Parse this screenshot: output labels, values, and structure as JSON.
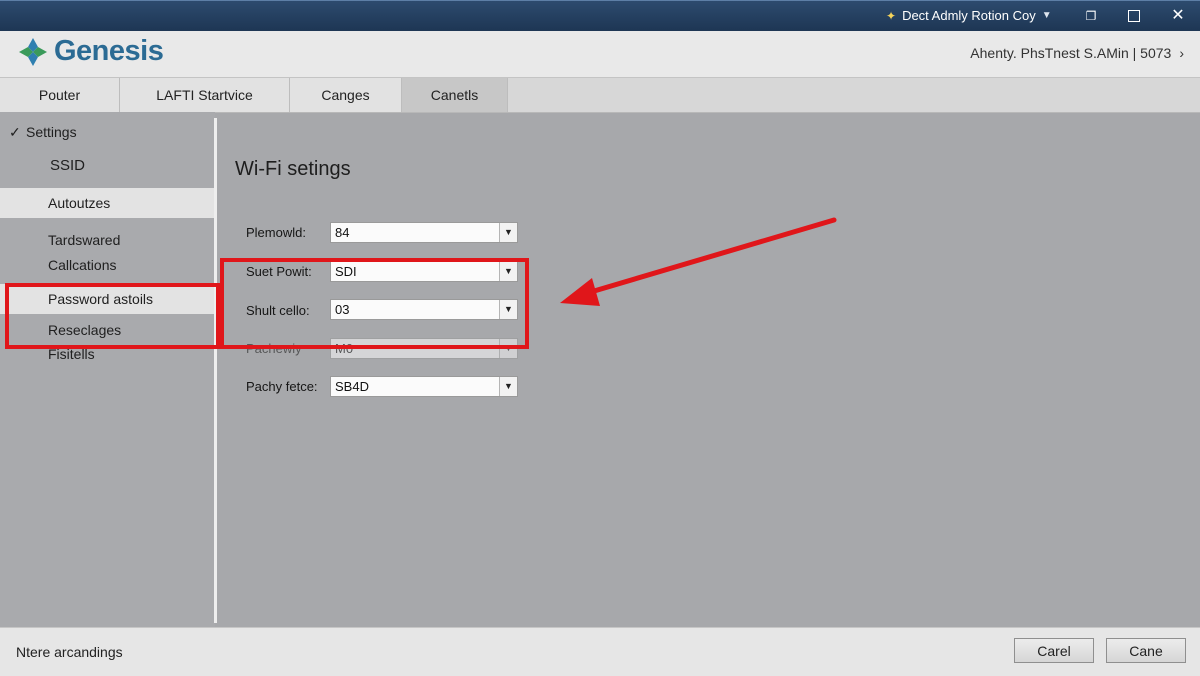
{
  "window": {
    "title": "Dect Admly Rotion Coy",
    "title_icon": "sparkle-icon",
    "controls": {
      "restore": "restore-icon",
      "maximize": "maximize-icon",
      "close": "close-icon"
    }
  },
  "header": {
    "brand": "Genesis",
    "account": "Ahenty. PhsTnest S.AMin | 5073",
    "account_chevron": "›"
  },
  "tabs": [
    {
      "label": "Pouter"
    },
    {
      "label": "LAFTI Startvice"
    },
    {
      "label": "Canges"
    },
    {
      "label": "Canetls"
    }
  ],
  "sidebar": {
    "section": "Settings",
    "items": [
      {
        "label": "SSID"
      },
      {
        "label": "Autoutzes"
      },
      {
        "label": "Tardswared"
      },
      {
        "label": "Callcations"
      },
      {
        "label": "Password astoils"
      },
      {
        "label": "Reseclages"
      },
      {
        "label": "Fisitells"
      }
    ]
  },
  "main": {
    "title": "Wi-Fi setings",
    "fields": [
      {
        "label": "Plemowld:",
        "value": "84"
      },
      {
        "label": "Suet Powit:",
        "value": "SDI"
      },
      {
        "label": "Shult cello:",
        "value": "03"
      },
      {
        "label": "Pachewiy",
        "value": "M0"
      },
      {
        "label": "Pachy fetce:",
        "value": "SB4D"
      }
    ]
  },
  "footer": {
    "status": "Ntere arcandings",
    "buttons": {
      "primary": "Carel",
      "secondary": "Cane"
    }
  },
  "colors": {
    "annotation": "#e0161a",
    "brand": "#2b6b94",
    "titlebar": "#1d3553",
    "background": "#a7a8ab"
  }
}
